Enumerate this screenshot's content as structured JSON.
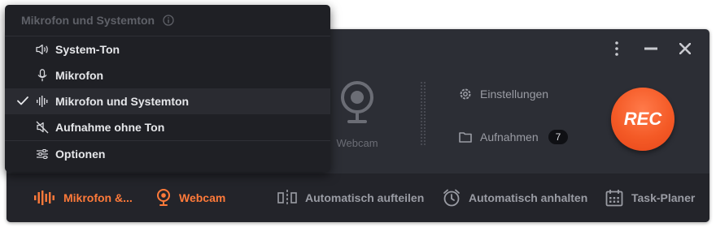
{
  "menu": {
    "header": "Mikrofon und Systemton",
    "items": [
      {
        "label": "System-Ton",
        "icon": "speaker-icon"
      },
      {
        "label": "Mikrofon",
        "icon": "microphone-icon"
      },
      {
        "label": "Mikrofon und Systemton",
        "icon": "audio-waveform-icon",
        "selected": true
      },
      {
        "label": "Aufnahme ohne Ton",
        "icon": "mute-icon"
      },
      {
        "label": "Optionen",
        "icon": "sliders-icon"
      }
    ]
  },
  "main": {
    "webcam_label": "Webcam",
    "settings_label": "Einstellungen",
    "recordings_label": "Aufnahmen",
    "recordings_count": "7",
    "rec_label": "REC"
  },
  "bottombar": {
    "audio_label": "Mikrofon &...",
    "webcam_label": "Webcam",
    "split_label": "Automatisch aufteilen",
    "stop_label": "Automatisch anhalten",
    "scheduler_label": "Task-Planer"
  },
  "colors": {
    "accent": "#ff7a3a",
    "rec": "#f45a26",
    "background": "#2c2e35",
    "menu_background": "#1f2025"
  }
}
